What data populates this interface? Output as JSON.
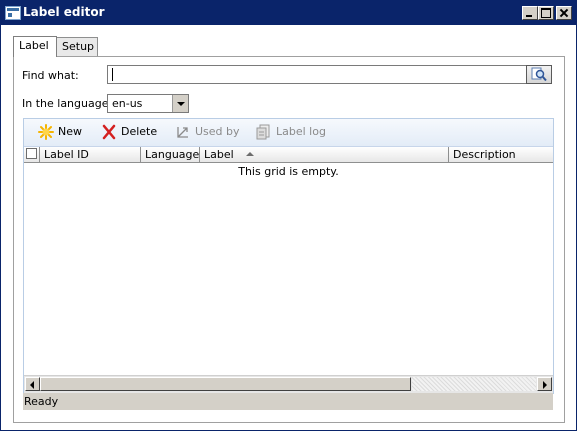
{
  "window": {
    "title": "Label editor"
  },
  "tabs": [
    {
      "label": "Label",
      "active": true
    },
    {
      "label": "Setup",
      "active": false
    }
  ],
  "find": {
    "label": "Find what:",
    "value": ""
  },
  "language": {
    "label": "In the language:",
    "value": "en-us"
  },
  "toolbar": {
    "new_label": "New",
    "delete_label": "Delete",
    "used_by_label": "Used by",
    "label_log_label": "Label log"
  },
  "grid": {
    "columns": [
      "Label ID",
      "Language",
      "Label",
      "Description"
    ],
    "sort_column": "Label",
    "empty_message": "This grid is empty."
  },
  "status": {
    "text": "Ready"
  },
  "colors": {
    "titlebar": "#0a246a",
    "toolbar": "#e3ecf7",
    "new_icon": "#f5b400",
    "delete_icon": "#d42020"
  }
}
